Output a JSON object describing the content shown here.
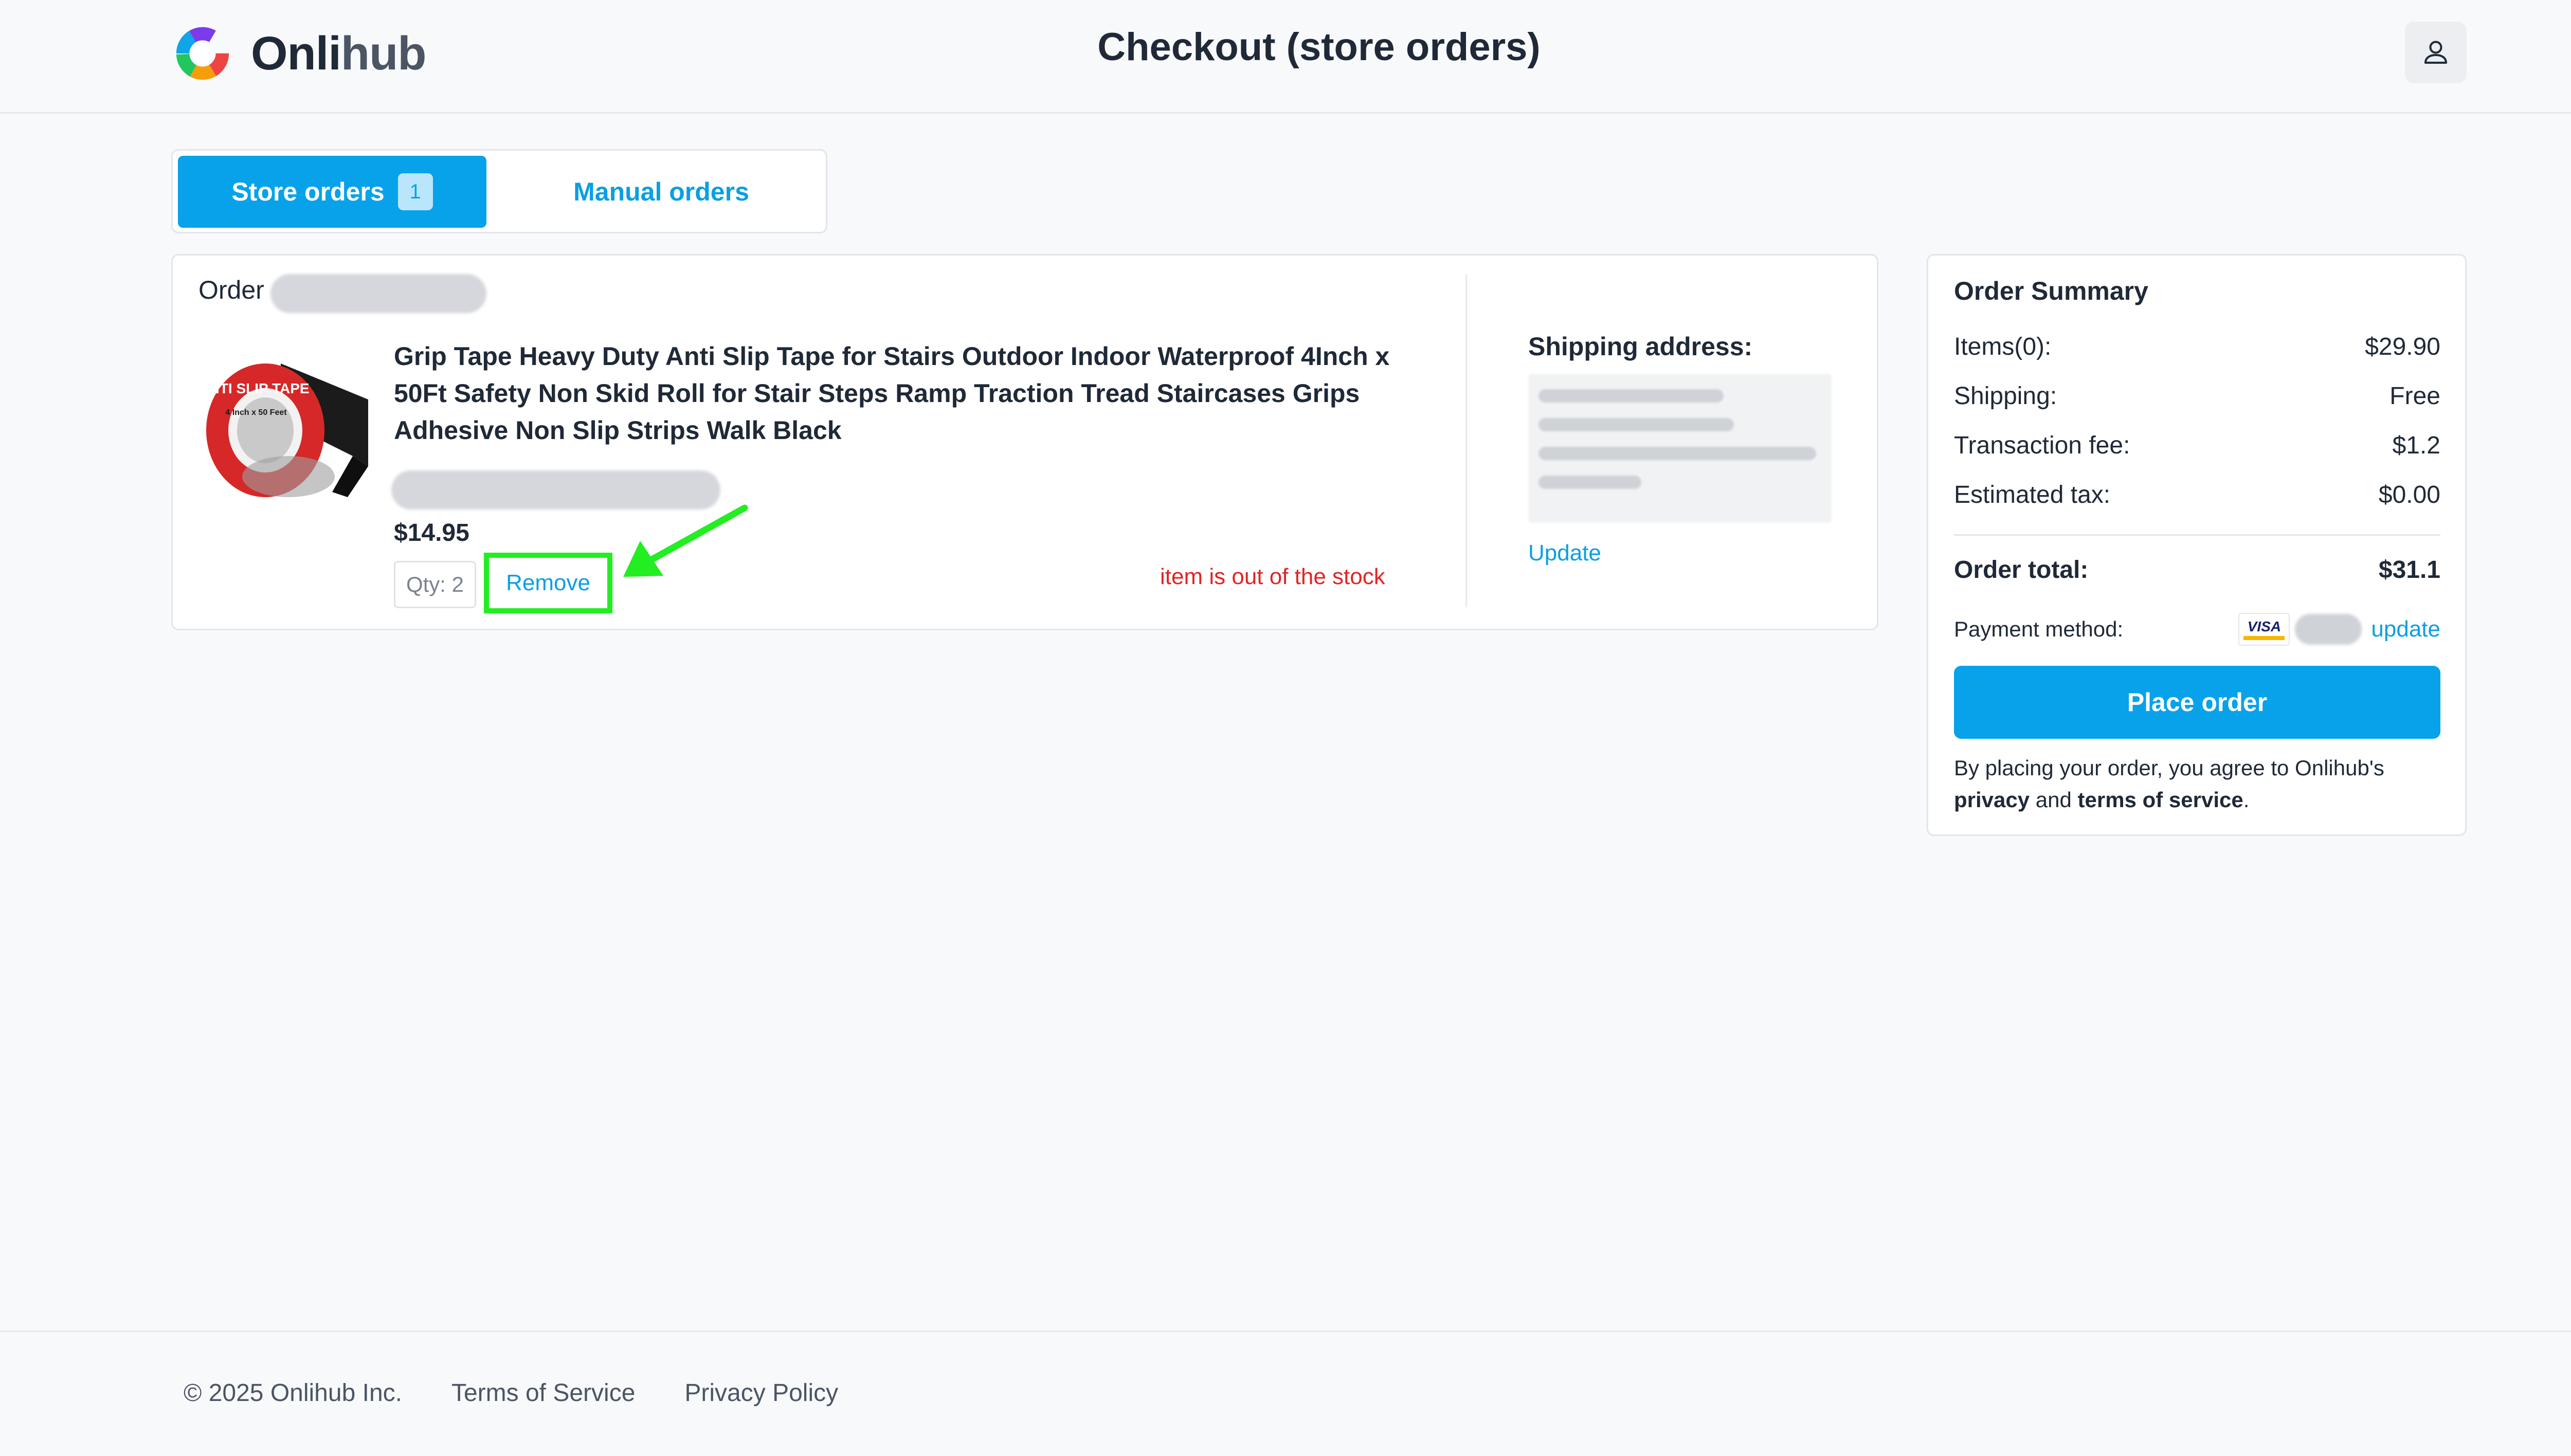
{
  "header": {
    "brand_name_part1": "Onli",
    "brand_name_part2": "hub",
    "page_title": "Checkout (store orders)"
  },
  "tabs": {
    "store_orders": "Store orders",
    "store_orders_count": "1",
    "manual_orders": "Manual orders"
  },
  "order": {
    "label": "Order",
    "product_title": "Grip Tape Heavy Duty Anti Slip Tape for Stairs Outdoor Indoor Waterproof 4Inch x 50Ft Safety Non Skid Roll for Stair Steps Ramp Traction Tread Staircases Grips Adhesive Non Slip Strips Walk Black",
    "product_image_text": "ANTI SLIP TAPE",
    "product_image_sub": "4 Inch x 50 Feet",
    "price": "$14.95",
    "qty": "Qty: 2",
    "remove": "Remove",
    "stock_message": "item is out of the stock",
    "shipping_title": "Shipping address:",
    "shipping_update": "Update"
  },
  "summary": {
    "title": "Order Summary",
    "items_label": "Items(0):",
    "items_value": "$29.90",
    "shipping_label": "Shipping:",
    "shipping_value": "Free",
    "fee_label": "Transaction fee:",
    "fee_value": "$1.2",
    "tax_label": "Estimated tax:",
    "tax_value": "$0.00",
    "total_label": "Order total:",
    "total_value": "$31.1",
    "payment_label": "Payment method:",
    "card_brand": "VISA",
    "payment_update": "update",
    "place_order": "Place order",
    "agree_text": "By placing your order, you agree to Onlihub's",
    "privacy": "privacy",
    "and": "and",
    "terms": "terms of service",
    "period": "."
  },
  "footer": {
    "copyright": "© 2025 Onlihub Inc.",
    "terms": "Terms of Service",
    "privacy": "Privacy Policy"
  },
  "colors": {
    "accent": "#08a2ea",
    "link": "#0a9fe3",
    "error": "#e02424",
    "highlight": "#22ee22"
  }
}
